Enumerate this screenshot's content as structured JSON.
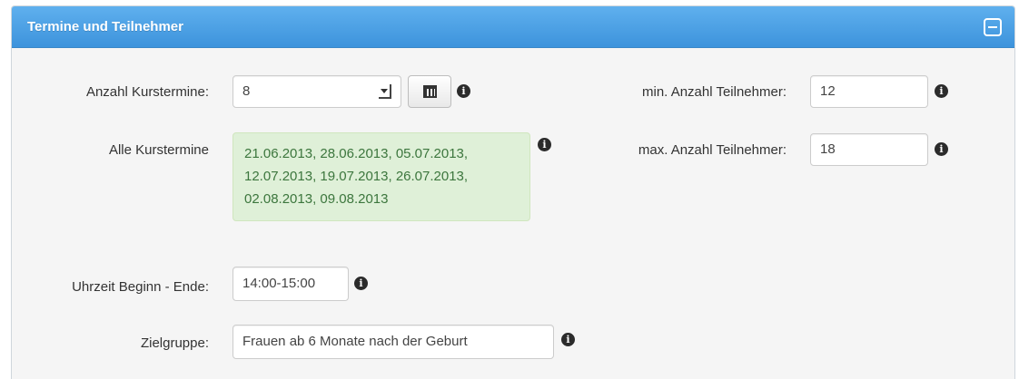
{
  "panel": {
    "title": "Termine und Teilnehmer"
  },
  "fields": {
    "anzahl_kurstermine": {
      "label": "Anzahl Kurstermine:",
      "value": "8"
    },
    "alle_kurstermine": {
      "label": "Alle Kurstermine",
      "lines": [
        "21.06.2013, 28.06.2013, 05.07.2013,",
        "12.07.2013, 19.07.2013, 26.07.2013,",
        "02.08.2013, 09.08.2013"
      ]
    },
    "min_teilnehmer": {
      "label": "min. Anzahl Teilnehmer:",
      "value": "12"
    },
    "max_teilnehmer": {
      "label": "max. Anzahl Teilnehmer:",
      "value": "18"
    },
    "uhrzeit": {
      "label": "Uhrzeit Beginn - Ende:",
      "value": "14:00-15:00"
    },
    "zielgruppe": {
      "label": "Zielgruppe:",
      "value": "Frauen ab 6 Monate nach der Geburt"
    }
  },
  "icons": {
    "info_glyph": "i",
    "collapse": "minus-square-icon",
    "calendar": "calendar-icon"
  },
  "colors": {
    "header": "#3d93dc",
    "success_bg": "#dff0d8",
    "success_text": "#3c763d"
  }
}
